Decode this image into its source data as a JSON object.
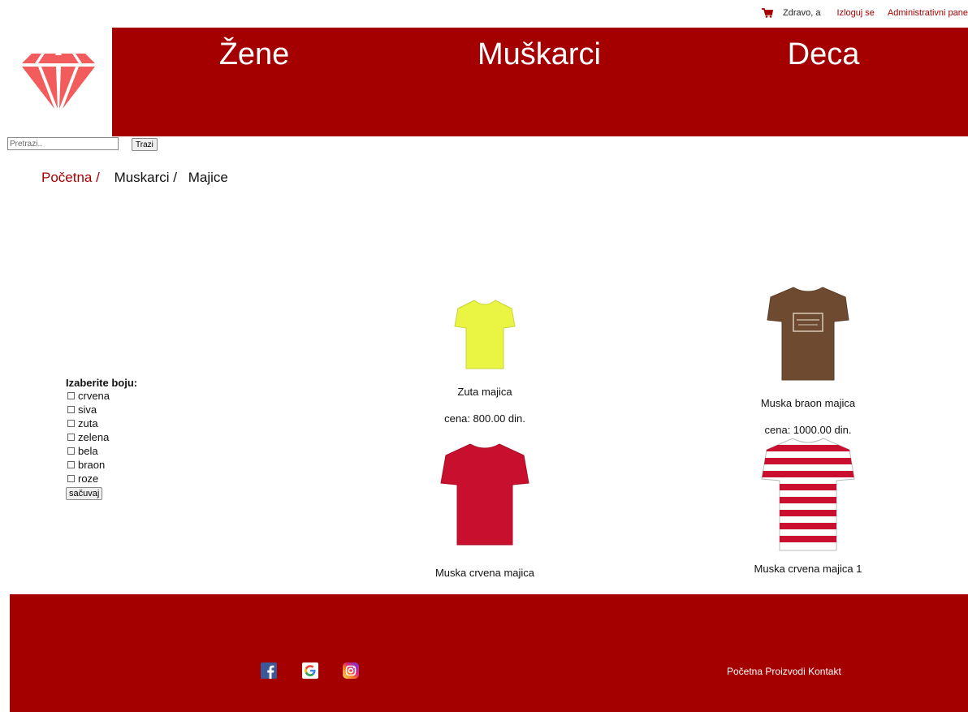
{
  "header": {
    "cart_icon": "cart-icon",
    "greeting": "Zdravo, a",
    "logout": "Izloguj se",
    "admin": "Administrativni pane"
  },
  "logo_icon": "diamond-logo-icon",
  "nav": {
    "women": "Žene",
    "men": "Muškarci",
    "kids": "Deca"
  },
  "search": {
    "placeholder": "Pretrazi..",
    "button": "Trazi"
  },
  "breadcrumb": {
    "home": "Početna /",
    "category": "Muskarci /",
    "current": "Majice"
  },
  "filter": {
    "title": "Izaberite boju:",
    "options": [
      "crvena",
      "siva",
      "zuta",
      "zelena",
      "bela",
      "braon",
      "roze"
    ],
    "save": "sačuvaj"
  },
  "products": [
    {
      "name": "Zuta majica",
      "price": "cena: 800.00 din.",
      "color": "#e9f542"
    },
    {
      "name": "Muska braon majica",
      "price": "cena: 1000.00 din.",
      "color": "#6e4a31"
    },
    {
      "name": "Muska crvena majica",
      "color": "#c8102e"
    },
    {
      "name": "Muska crvena majica 1",
      "color": "#c8102e"
    }
  ],
  "footer": {
    "social": [
      "facebook-icon",
      "google-icon",
      "instagram-icon"
    ],
    "links": [
      "Početna",
      "Proizvodi",
      "Kontakt"
    ]
  },
  "colors": {
    "brand_red": "#a50000",
    "logo_red": "#f25c5c"
  }
}
